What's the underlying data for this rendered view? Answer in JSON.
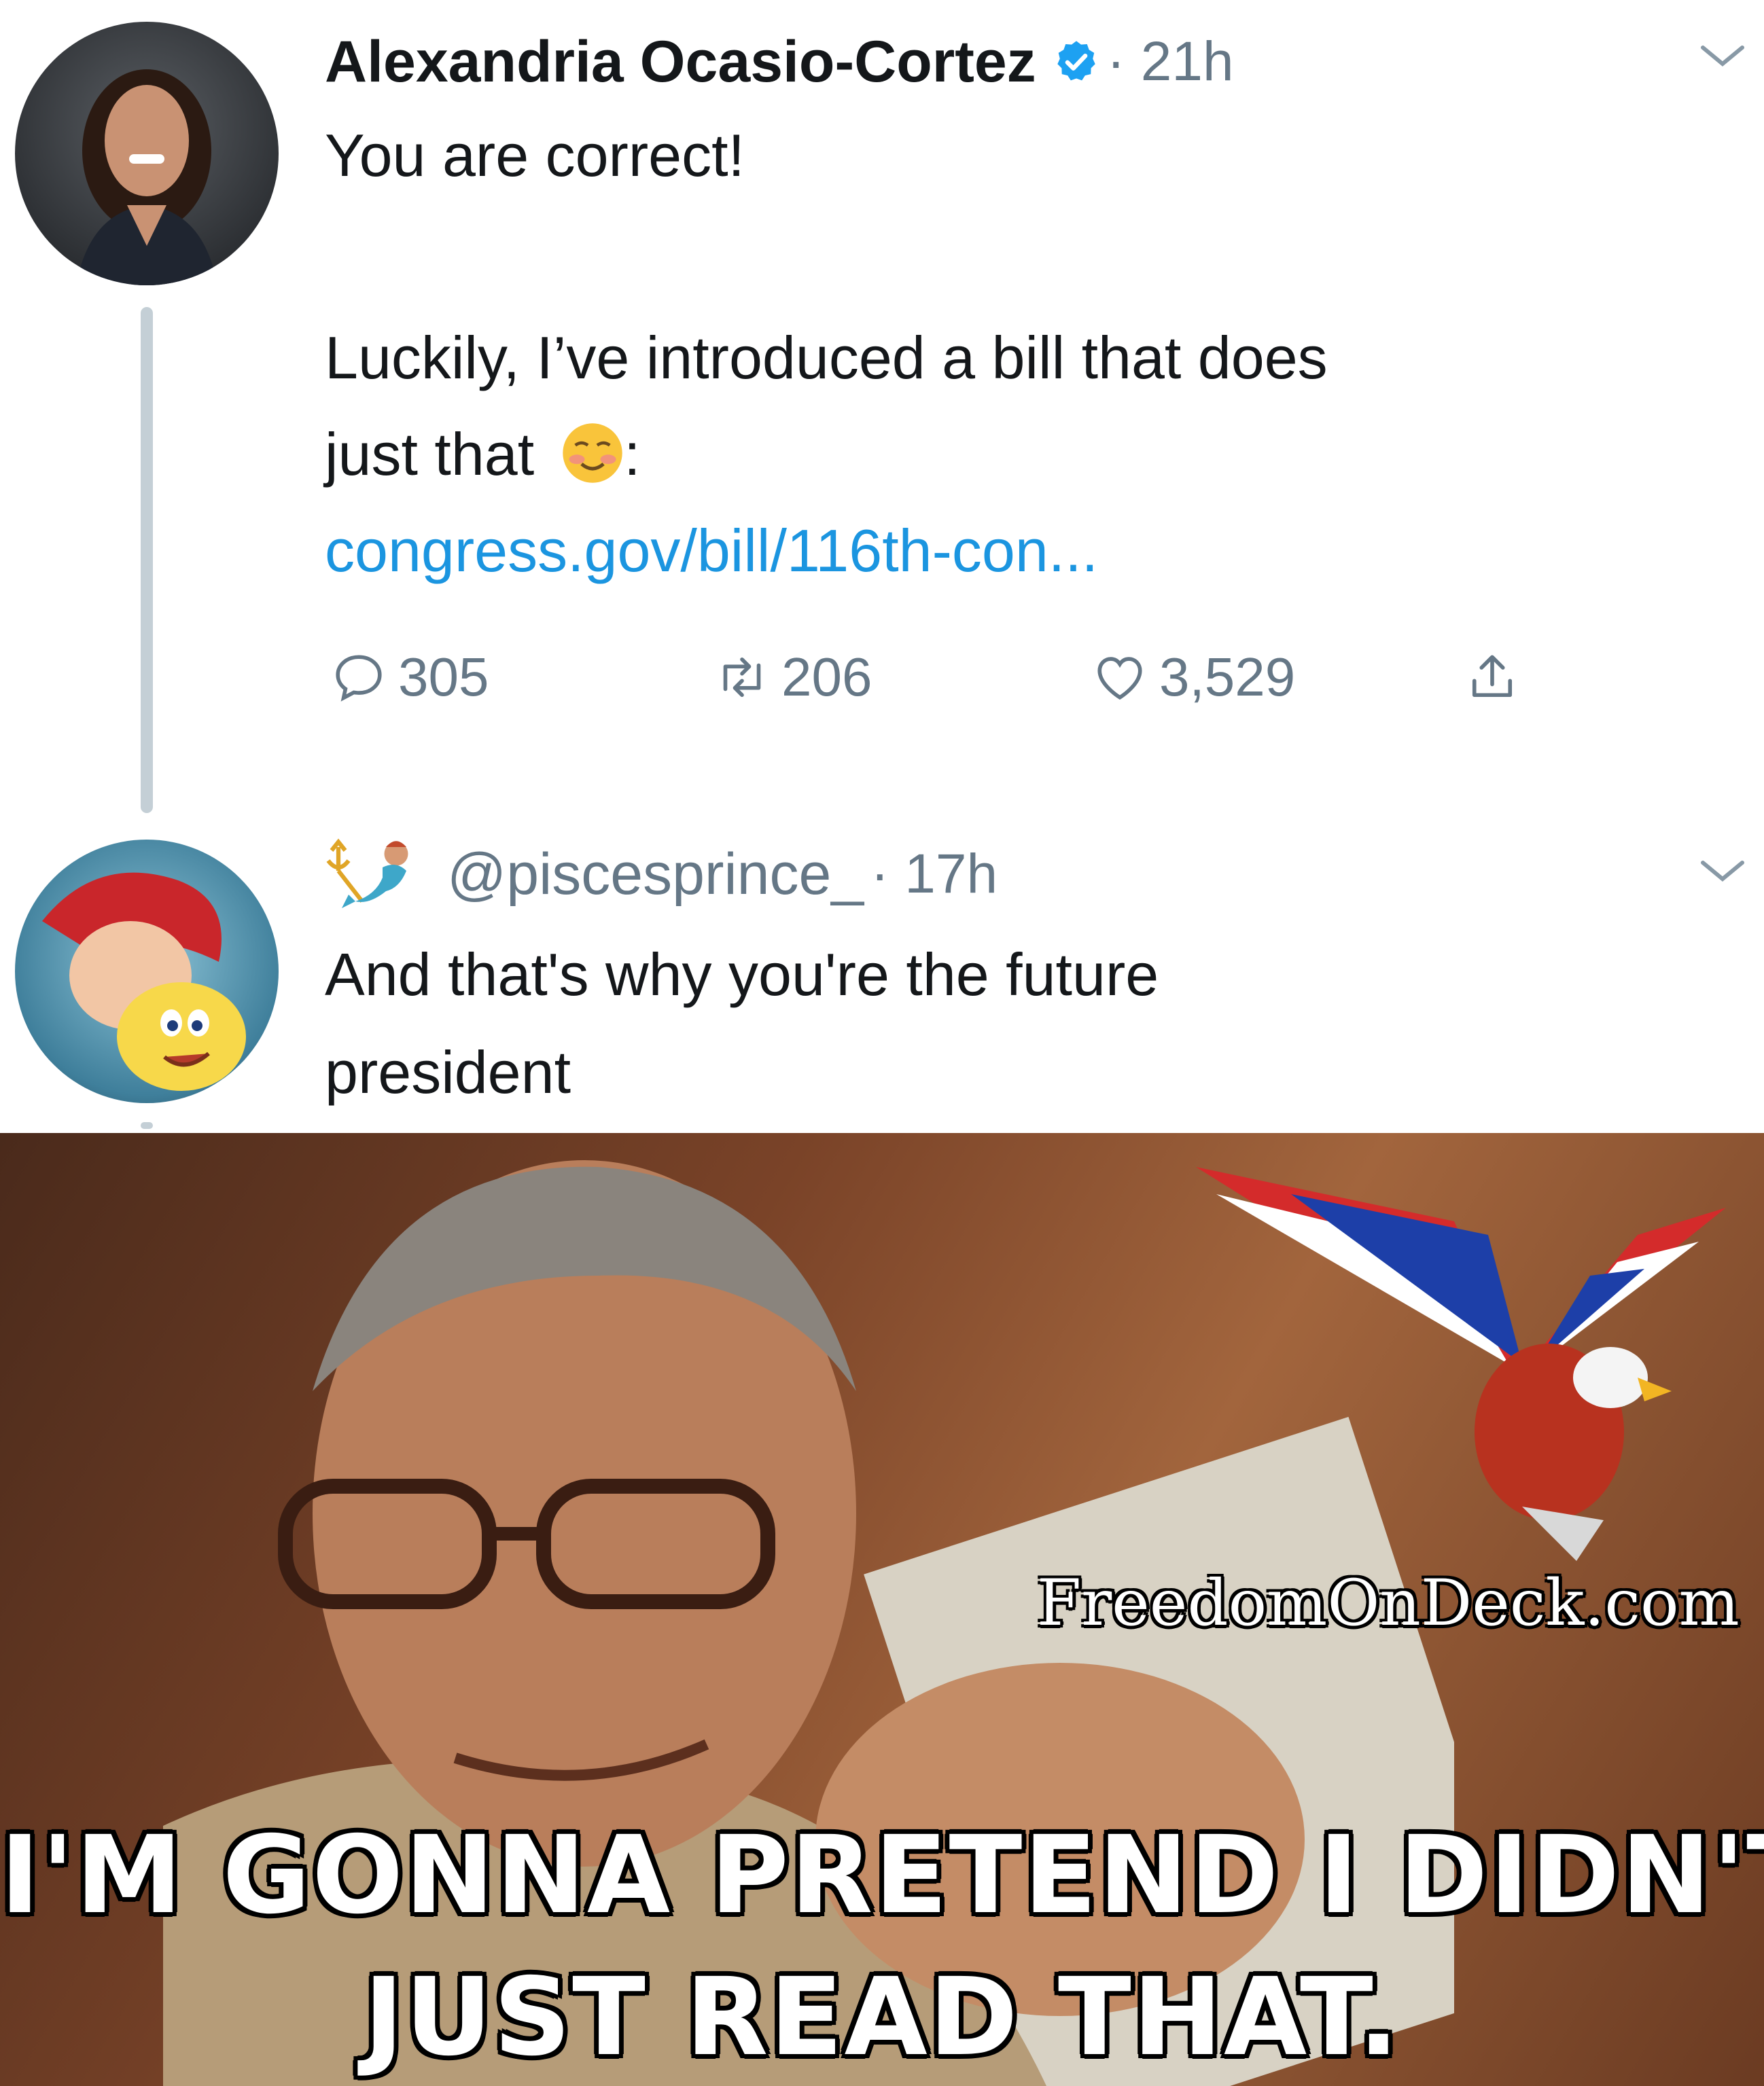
{
  "tweet": {
    "author_name": "Alexandria Ocasio-Cortez",
    "time": "· 21h",
    "line1": "You are correct!",
    "line2": "Luckily, I’ve introduced a bill that does",
    "line3": "just that",
    "line3_suffix": ":",
    "link": "congress.gov/bill/116th-con...",
    "replies": "305",
    "retweets": "206",
    "likes": "3,529",
    "icons": [
      "verified-badge-icon",
      "reply-icon",
      "retweet-icon",
      "like-icon",
      "share-icon",
      "chevron-down-icon",
      "smiling-face-emoji"
    ],
    "accent_color": "#1da1f2"
  },
  "reply": {
    "handle": "@piscesprince_",
    "time": "· 17h",
    "line1": "And that's why you're the future",
    "line2": "president"
  },
  "meme": {
    "watermark": "FreedomOnDeck.com",
    "caption_line1": "I'M GONNA PRETEND I DIDN'T",
    "caption_line2": "JUST READ THAT."
  }
}
